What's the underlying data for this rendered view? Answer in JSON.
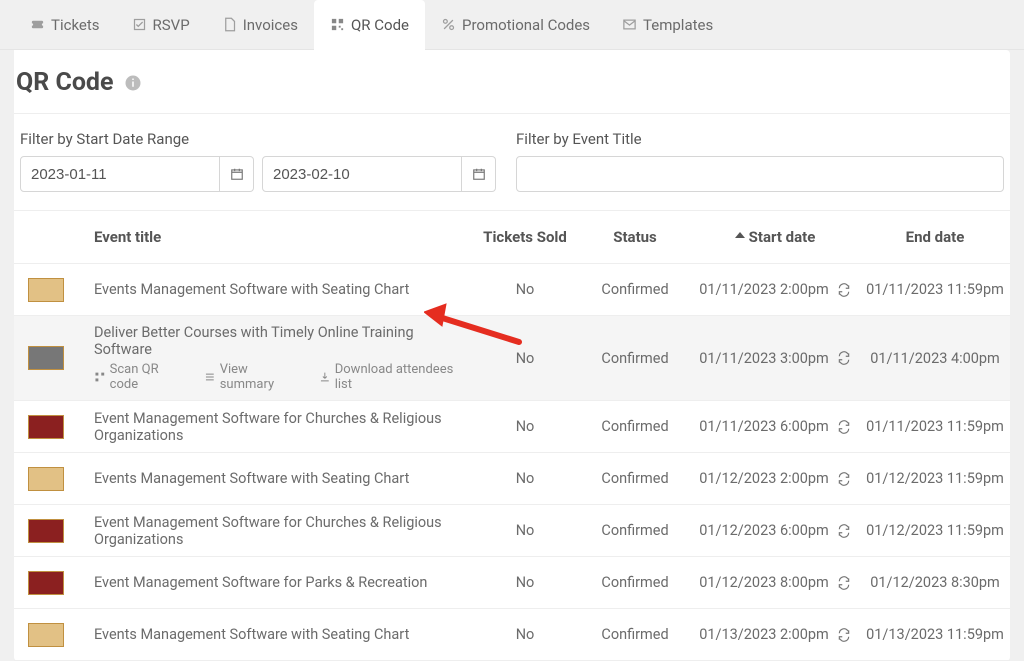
{
  "tabs": [
    {
      "label": "Tickets"
    },
    {
      "label": "RSVP"
    },
    {
      "label": "Invoices"
    },
    {
      "label": "QR Code"
    },
    {
      "label": "Promotional Codes"
    },
    {
      "label": "Templates"
    }
  ],
  "page_title": "QR Code",
  "filters": {
    "date_label": "Filter by Start Date Range",
    "title_label": "Filter by Event Title",
    "start_date": "2023-01-11",
    "end_date": "2023-02-10",
    "title_value": ""
  },
  "columns": {
    "title": "Event title",
    "sold": "Tickets Sold",
    "status": "Status",
    "start": "Start date",
    "end": "End date"
  },
  "row_actions": {
    "scan": "Scan QR code",
    "summary": "View summary",
    "download": "Download attendees list"
  },
  "rows": [
    {
      "title": "Events Management Software with Seating Chart",
      "sold": "No",
      "status": "Confirmed",
      "start": "01/11/2023 2:00pm",
      "end": "01/11/2023 11:59pm",
      "thumb": "yellow"
    },
    {
      "title": "Deliver Better Courses with Timely Online Training Software",
      "sold": "No",
      "status": "Confirmed",
      "start": "01/11/2023 3:00pm",
      "end": "01/11/2023 4:00pm",
      "thumb": "photo",
      "highlight": true
    },
    {
      "title": "Event Management Software for Churches & Religious Organizations",
      "sold": "No",
      "status": "Confirmed",
      "start": "01/11/2023 6:00pm",
      "end": "01/11/2023 11:59pm",
      "thumb": "red"
    },
    {
      "title": "Events Management Software with Seating Chart",
      "sold": "No",
      "status": "Confirmed",
      "start": "01/12/2023 2:00pm",
      "end": "01/12/2023 11:59pm",
      "thumb": "yellow"
    },
    {
      "title": "Event Management Software for Churches & Religious Organizations",
      "sold": "No",
      "status": "Confirmed",
      "start": "01/12/2023 6:00pm",
      "end": "01/12/2023 11:59pm",
      "thumb": "red"
    },
    {
      "title": "Event Management Software for Parks & Recreation",
      "sold": "No",
      "status": "Confirmed",
      "start": "01/12/2023 8:00pm",
      "end": "01/12/2023 8:30pm",
      "thumb": "red"
    },
    {
      "title": "Events Management Software with Seating Chart",
      "sold": "No",
      "status": "Confirmed",
      "start": "01/13/2023 2:00pm",
      "end": "01/13/2023 11:59pm",
      "thumb": "yellow"
    }
  ]
}
